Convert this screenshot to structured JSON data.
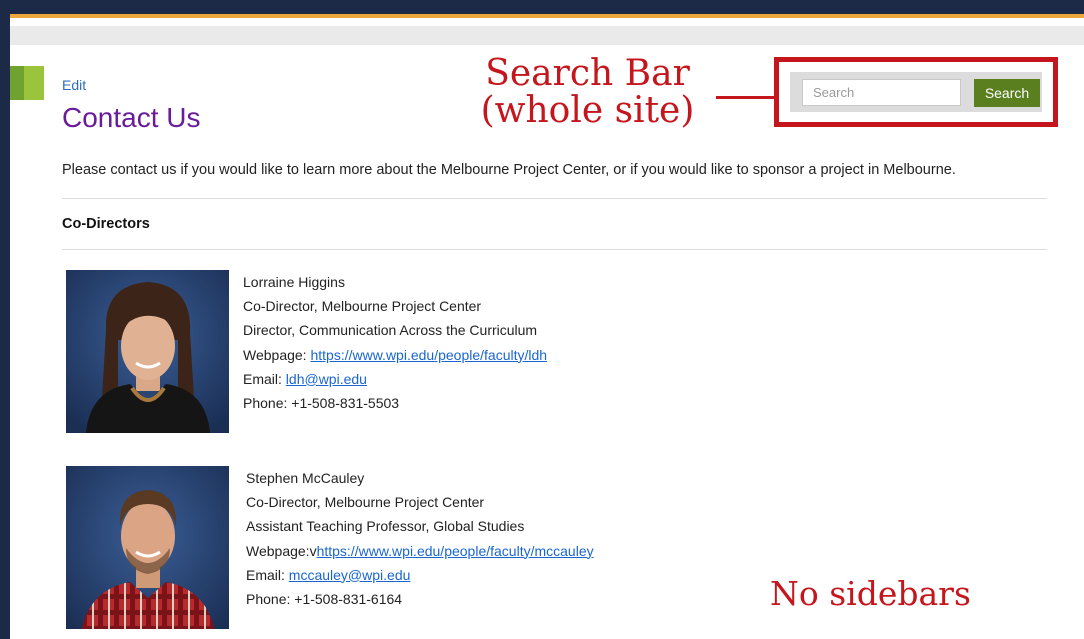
{
  "header": {
    "edit_label": "Edit",
    "page_title": "Contact Us"
  },
  "search": {
    "placeholder": "Search",
    "button_label": "Search"
  },
  "annotations": {
    "search_bar_line1": "Search  Bar",
    "search_bar_line2": "(whole  site)",
    "no_sidebars": "No  sidebars"
  },
  "content": {
    "intro": "Please contact us if you would like to learn more about the Melbourne Project Center, or if you would like to sponsor a project in Melbourne.",
    "section_heading": "Co-Directors"
  },
  "people": [
    {
      "name": "Lorraine Higgins",
      "role1": "Co-Director, Melbourne Project Center",
      "role2": "Director, Communication Across the Curriculum",
      "webpage_prefix": "Webpage: ",
      "webpage": "https://www.wpi.edu/people/faculty/ldh",
      "email_prefix": "Email: ",
      "email": "ldh@wpi.edu",
      "phone": "Phone: +1-508-831-5503"
    },
    {
      "name": "Stephen McCauley",
      "role1": "Co-Director, Melbourne Project Center",
      "role2": "Assistant Teaching Professor, Global Studies",
      "webpage_prefix": "Webpage:v",
      "webpage": "https://www.wpi.edu/people/faculty/mccauley",
      "email_prefix": "Email: ",
      "email": "mccauley@wpi.edu",
      "phone": "Phone: +1-508-831-6164"
    }
  ],
  "colors": {
    "navy": "#1c2a48",
    "gold": "#f0a73a",
    "title_purple": "#6a1b9a",
    "link_blue": "#1a66d0",
    "search_green": "#5a7f1e",
    "annotation_red": "#c4161c"
  }
}
